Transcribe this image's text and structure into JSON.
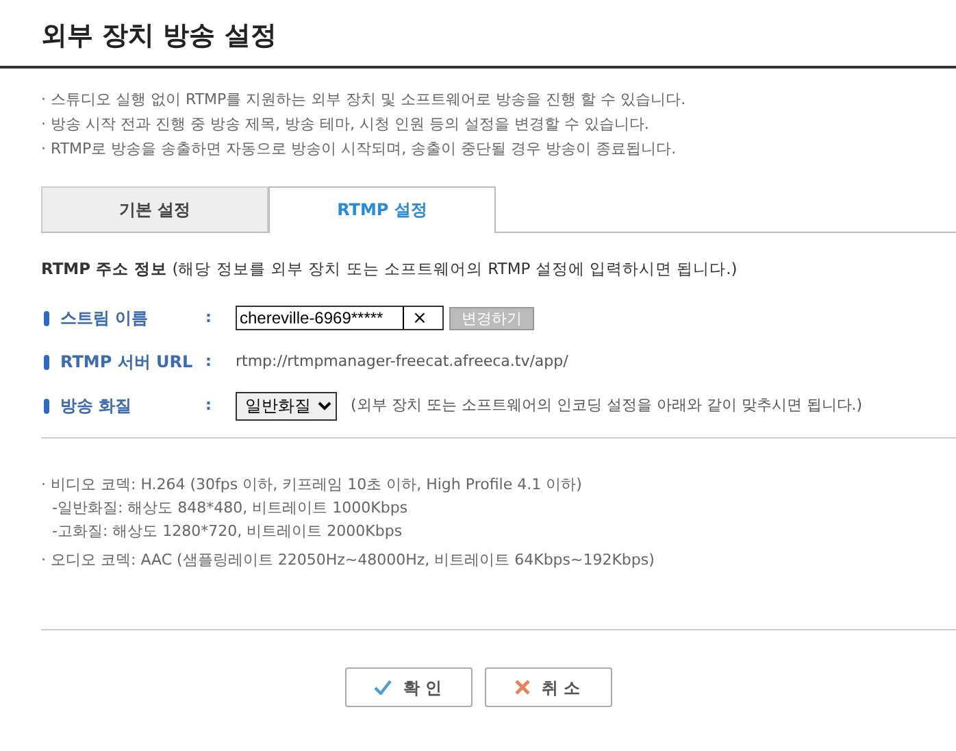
{
  "title": "외부 장치 방송 설정",
  "notices": [
    "· 스튜디오 실행 없이 RTMP를 지원하는 외부 장치 및 소프트웨어로 방송을 진행 할 수 있습니다.",
    "· 방송 시작 전과 진행 중 방송 제목, 방송 테마, 시청 인원 등의 설정을 변경할 수 있습니다.",
    "· RTMP로 방송을 송출하면 자동으로 방송이 시작되며, 송출이 중단될 경우 방송이 종료됩니다."
  ],
  "tabs": [
    {
      "label": "기본 설정",
      "selected": false
    },
    {
      "label": "RTMP 설정",
      "selected": true
    }
  ],
  "section": "**RTMP 주소 정보** (해당 정보를 외부 장치 또는 소프트웨어의 RTMP 설정에 입력하시면 됩니다.)",
  "fields": [
    {
      "kind": "input",
      "label": "스트림 이름",
      "colon": ":",
      "value": "chereville-6969*****",
      "clear": "×",
      "button": "변경하기"
    },
    {
      "kind": "text",
      "label": "RTMP 서버 URL",
      "colon": ":",
      "value": "rtmp://rtmpmanager-freecat.afreeca.tv/app/"
    },
    {
      "kind": "select",
      "label": "방송 화질",
      "colon": ":",
      "value": "일반화질",
      "note": "(외부 장치 또는 소프트웨어의 인코딩 설정을 아래와 같이 맞추시면 됩니다.)"
    }
  ],
  "codec_notes": [
    {
      "kind": "main",
      "text": "· 비디오 코덱: H.264 (30fps 이하, 키프레임 10초 이하, High Profile 4.1 이하)"
    },
    {
      "kind": "sub",
      "text": "-일반화질: 해상도 848*480, 비트레이트 1000Kbps"
    },
    {
      "kind": "sub",
      "text": "-고화질: 해상도 1280*720, 비트레이트 2000Kbps"
    },
    {
      "kind": "main",
      "text": "· 오디오 코덱: AAC (샘플링레이트 22050Hz~48000Hz, 비트레이트 64Kbps~192Kbps)"
    }
  ],
  "buttons": [
    {
      "kind": "confirm",
      "label": "확 인"
    },
    {
      "kind": "cancel",
      "label": "취 소"
    }
  ]
}
